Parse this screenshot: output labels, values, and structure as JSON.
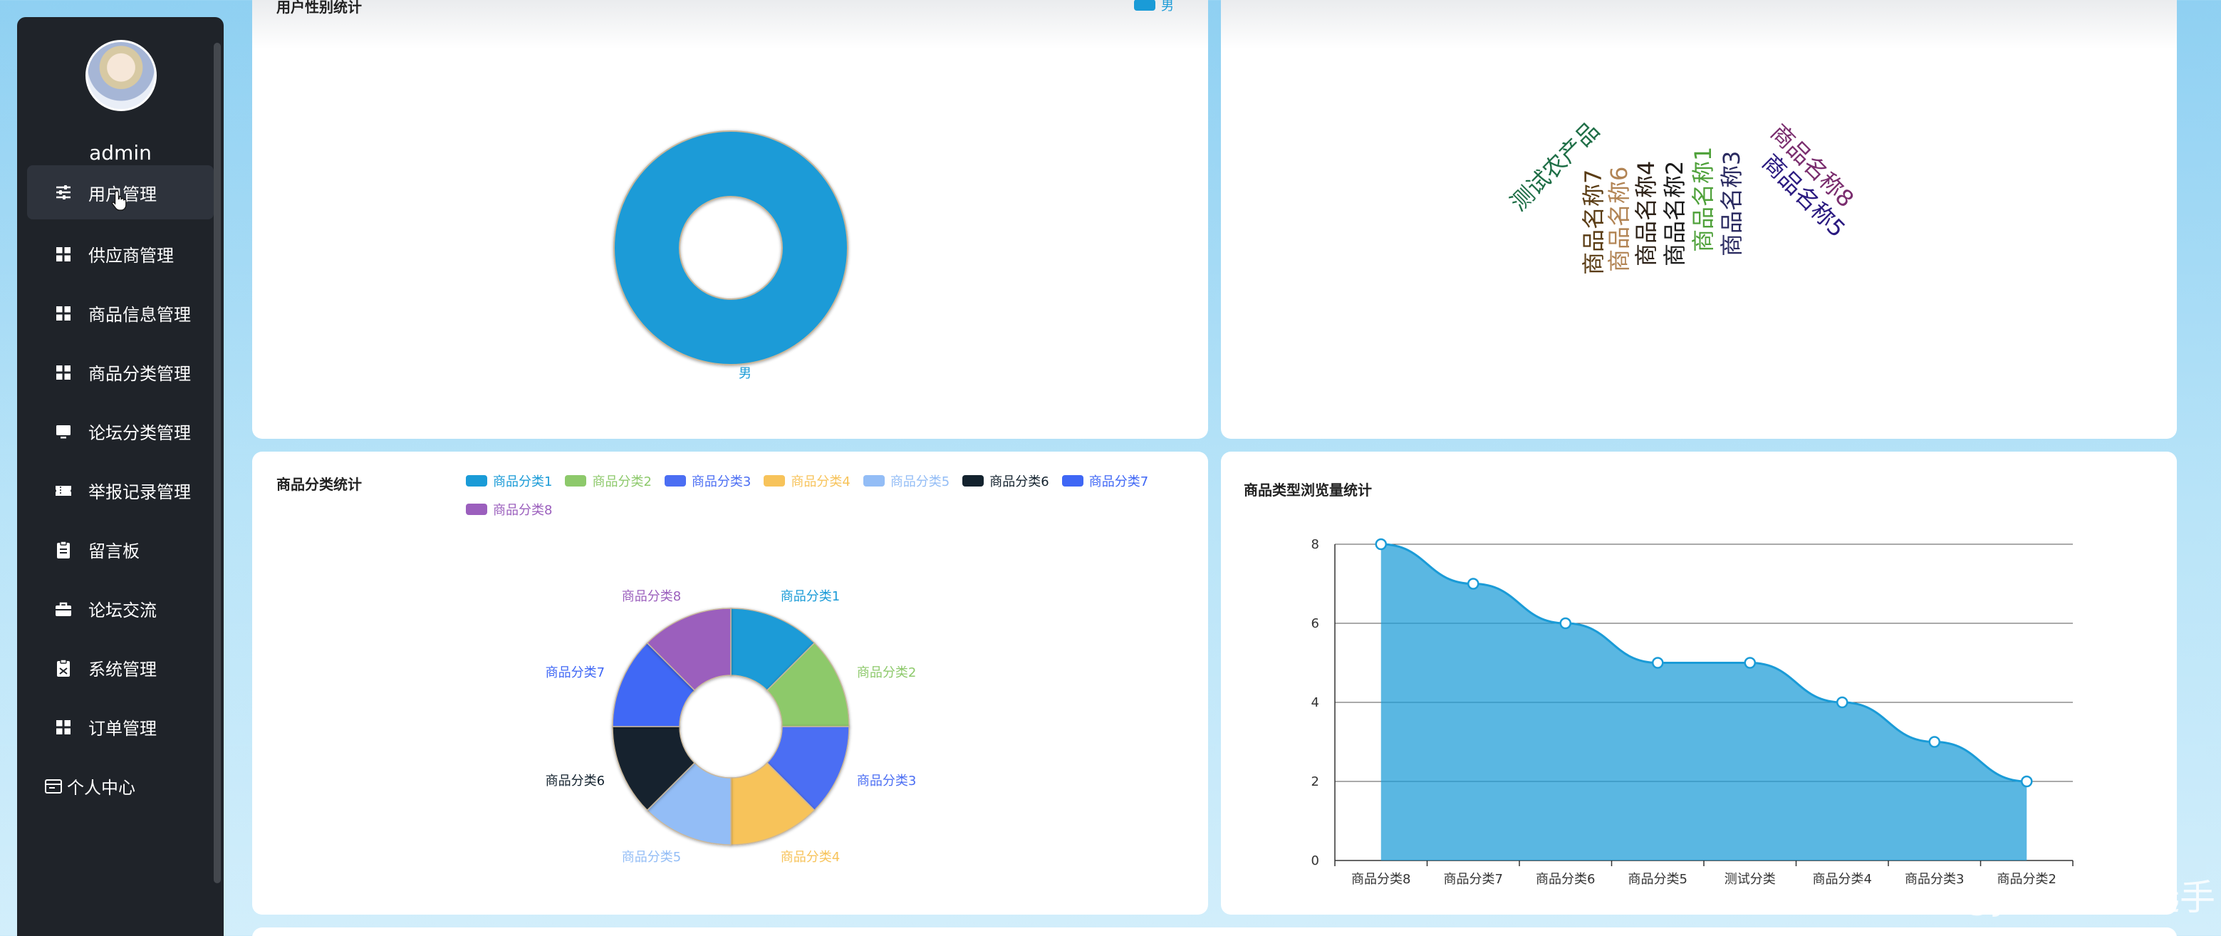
{
  "sidebar": {
    "username": "admin",
    "menu": [
      {
        "label": "用户管理",
        "icon": "sliders-icon"
      },
      {
        "label": "供应商管理",
        "icon": "grid-icon"
      },
      {
        "label": "商品信息管理",
        "icon": "grid-icon"
      },
      {
        "label": "商品分类管理",
        "icon": "grid-icon"
      },
      {
        "label": "论坛分类管理",
        "icon": "monitor-icon"
      },
      {
        "label": "举报记录管理",
        "icon": "ticket-icon"
      },
      {
        "label": "留言板",
        "icon": "clipboard-icon"
      },
      {
        "label": "论坛交流",
        "icon": "briefcase-icon"
      },
      {
        "label": "系统管理",
        "icon": "clipboard-check-icon"
      },
      {
        "label": "订单管理",
        "icon": "grid-icon"
      }
    ],
    "personal_center": "个人中心"
  },
  "colors": {
    "sidebar_bg": "#1f2329",
    "active_bg": "#2e333c",
    "primary": "#1a9bd7"
  },
  "watermark": "CSDN @JAVA编码选手",
  "chart_data": [
    {
      "type": "pie",
      "title": "用户性别统计",
      "categories": [
        "男"
      ],
      "values": [
        1
      ],
      "legend": "top-right"
    },
    {
      "type": "wordcloud",
      "words": [
        "测试农产品",
        "商品名称7",
        "商品名称6",
        "商品名称4",
        "商品名称2",
        "商品名称1",
        "商品名称3",
        "商品名称8",
        "商品名称5"
      ]
    },
    {
      "type": "pie",
      "title": "商品分类统计",
      "categories": [
        "商品分类1",
        "商品分类2",
        "商品分类3",
        "商品分类4",
        "商品分类5",
        "商品分类6",
        "商品分类7",
        "商品分类8"
      ],
      "values": [
        1,
        1,
        1,
        1,
        1,
        1,
        1,
        1
      ],
      "colors": [
        "#1a9bd7",
        "#8dc96b",
        "#4b6ef3",
        "#f7c35a",
        "#93bdf6",
        "#13222e",
        "#3f67f5",
        "#9b5fbd"
      ],
      "legend": "top"
    },
    {
      "type": "area",
      "title": "商品类型浏览量统计",
      "categories": [
        "商品分类8",
        "商品分类7",
        "商品分类6",
        "商品分类5",
        "测试分类",
        "商品分类4",
        "商品分类3",
        "商品分类2"
      ],
      "values": [
        8,
        7,
        6,
        5,
        5,
        4,
        3,
        2
      ],
      "ylim": [
        0,
        8
      ],
      "yticks": [
        0,
        2,
        4,
        6,
        8
      ],
      "grid": true
    }
  ]
}
